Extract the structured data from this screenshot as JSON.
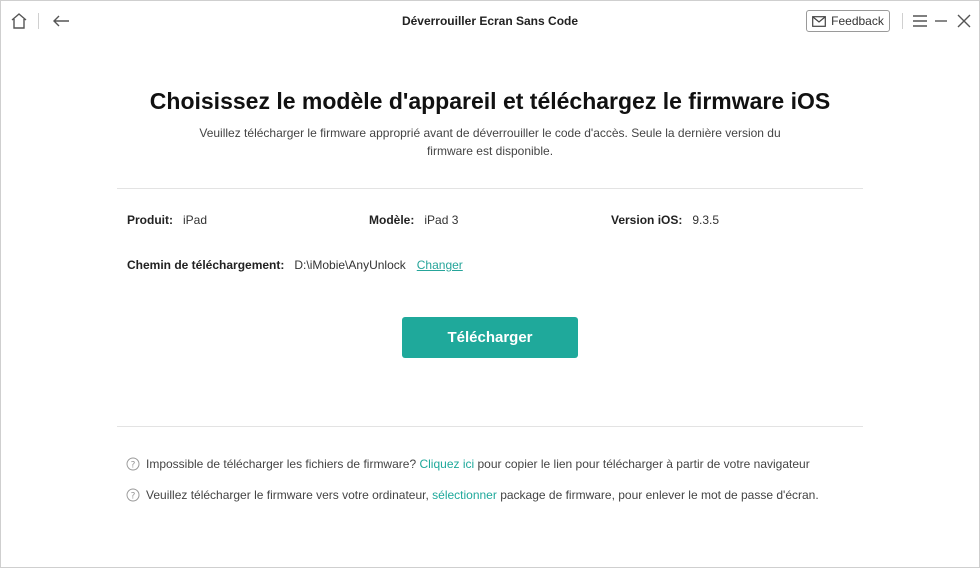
{
  "window": {
    "title": "Déverrouiller Ecran Sans Code",
    "feedback_label": "Feedback"
  },
  "page": {
    "heading": "Choisissez le modèle d'appareil et téléchargez le firmware iOS",
    "subtitle_line1": "Veuillez télécharger le firmware approprié avant de déverrouiller le code d'accès. Seule la dernière version du",
    "subtitle_line2": "firmware est disponible."
  },
  "device": {
    "product_label": "Produit:",
    "product_value": "iPad",
    "model_label": "Modèle:",
    "model_value": "iPad 3",
    "ios_label": "Version iOS:",
    "ios_value": "9.3.5"
  },
  "download": {
    "path_label": "Chemin de téléchargement:",
    "path_value": "D:\\iMobie\\AnyUnlock",
    "change_label": "Changer",
    "button_label": "Télécharger"
  },
  "notes": [
    {
      "before": "Impossible de télécharger les fichiers de firmware?",
      "link": "Cliquez ici",
      "after": "pour copier le lien pour télécharger à partir de votre navigateur"
    },
    {
      "before": "Veuillez télécharger le firmware vers votre ordinateur,",
      "link": "sélectionner",
      "after": "package de firmware, pour enlever le mot de passe d'écran."
    }
  ],
  "colors": {
    "accent": "#1fa99b",
    "link": "#26a59a"
  },
  "icons": [
    "home-icon",
    "back-arrow-icon",
    "mail-icon",
    "menu-icon",
    "minimize-icon",
    "close-icon",
    "question-circle-icon"
  ]
}
